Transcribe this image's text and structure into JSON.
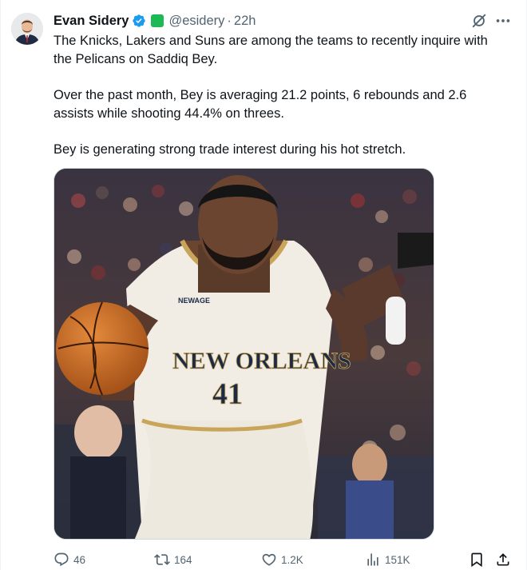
{
  "author": {
    "name": "Evan Sidery",
    "handle": "@esidery",
    "separator": "·",
    "time": "22h",
    "verified": true,
    "affiliate_badge_color": "#1db954"
  },
  "tweet": {
    "paragraphs": [
      "The Knicks, Lakers and Suns are among the teams to recently inquire with the Pelicans on Saddiq Bey.",
      "Over the past month, Bey is averaging 21.2 points, 6 rebounds and 2.6 assists while shooting 44.4% on threes.",
      "Bey is generating strong trade interest during his hot stretch."
    ]
  },
  "media": {
    "jersey_city": "NEW ORLEANS",
    "jersey_number": "41",
    "jersey_patch": "NEWAGE"
  },
  "actions": {
    "reply_count": "46",
    "retweet_count": "164",
    "like_count": "1.2K",
    "view_count": "151K"
  },
  "icons": {
    "verified": "verified-badge-icon",
    "grok": "grok-icon",
    "more": "more-horizontal-icon",
    "reply": "reply-icon",
    "retweet": "retweet-icon",
    "like": "heart-icon",
    "views": "views-chart-icon",
    "bookmark": "bookmark-icon",
    "share": "share-icon"
  },
  "colors": {
    "text_primary": "#0f1419",
    "text_secondary": "#536471",
    "verified_blue": "#1d9bf0"
  }
}
